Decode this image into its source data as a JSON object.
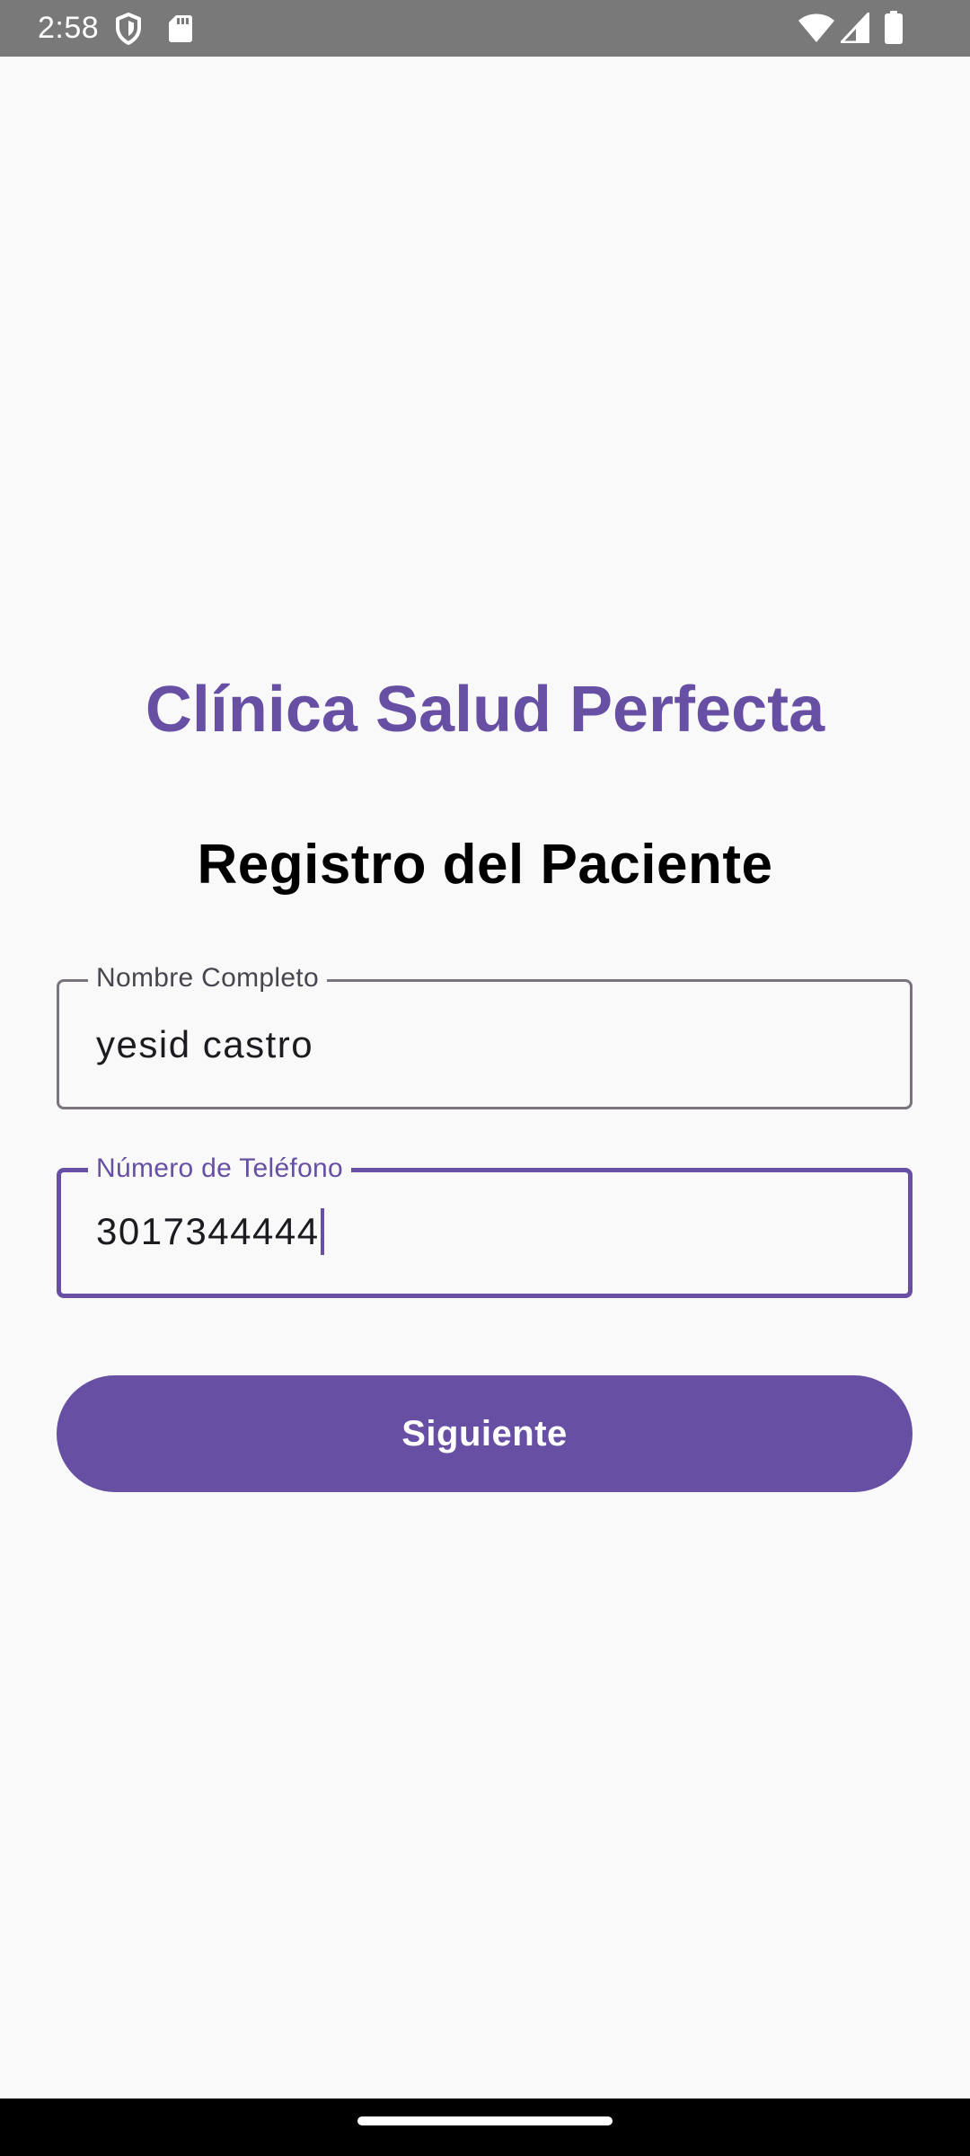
{
  "status_bar": {
    "time": "2:58",
    "left_icons": [
      "shield-icon",
      "sd-card-icon"
    ],
    "right_icons": [
      "wifi-icon",
      "cell-signal-icon",
      "battery-icon"
    ],
    "background_color": "#797979"
  },
  "app": {
    "clinic_name": "Clínica Salud Perfecta",
    "form_title": "Registro del Paciente",
    "accent_color": "#6750a4"
  },
  "form": {
    "name_field": {
      "label": "Nombre Completo",
      "value": "yesid castro"
    },
    "phone_field": {
      "label": "Número de Teléfono",
      "value": "3017344444",
      "focused": true
    },
    "next_button_label": "Siguiente"
  },
  "navigation": {
    "gesture_handle": "home-pill"
  }
}
